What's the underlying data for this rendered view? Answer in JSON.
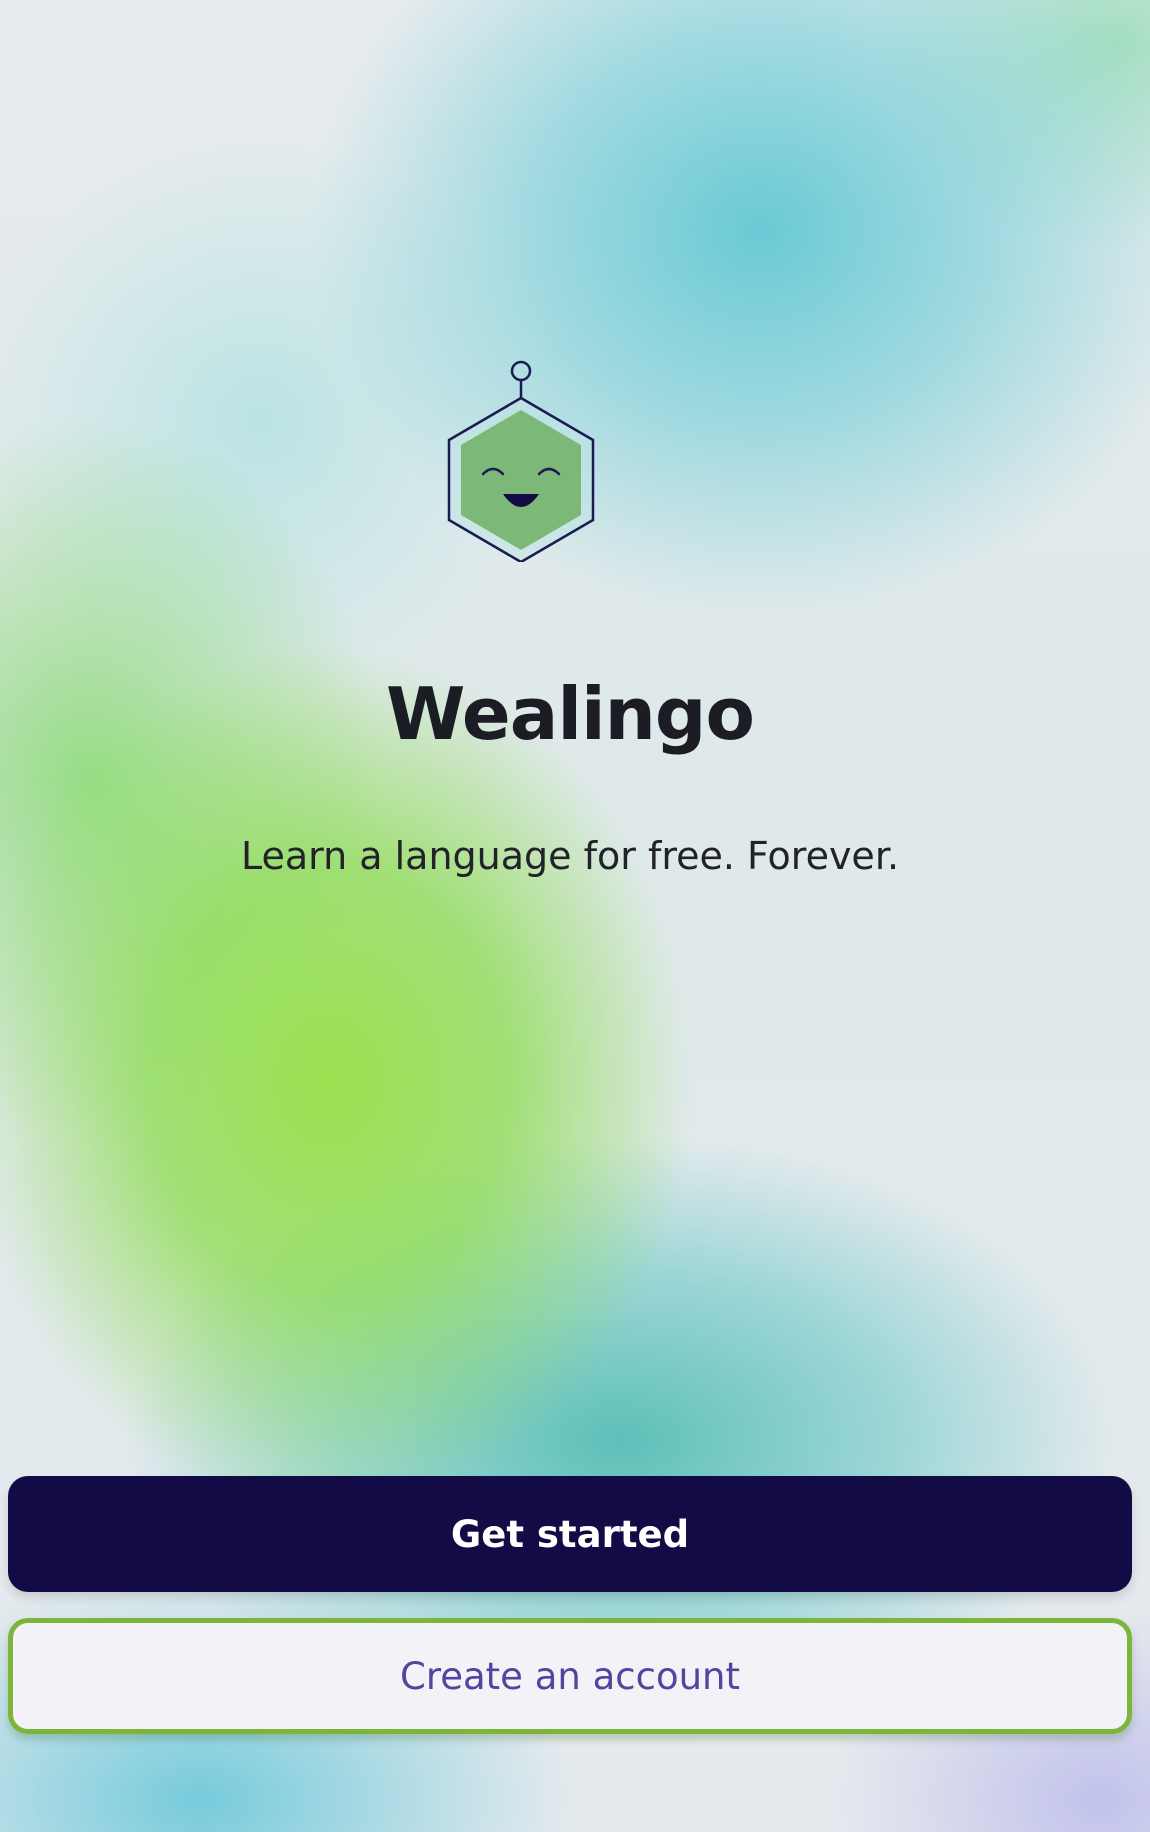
{
  "app": {
    "name": "Wealingo",
    "tagline": "Learn a language for free. Forever."
  },
  "actions": {
    "primary_label": "Get started",
    "secondary_label": "Create an account"
  },
  "colors": {
    "primary_button": "#120b45",
    "secondary_button_border": "#7db53b",
    "secondary_button_text": "#55449e",
    "mascot_fill": "#7cb978",
    "mascot_outline": "#1b1a52"
  },
  "icons": {
    "logo": "robot-hexagon-mascot-icon"
  }
}
